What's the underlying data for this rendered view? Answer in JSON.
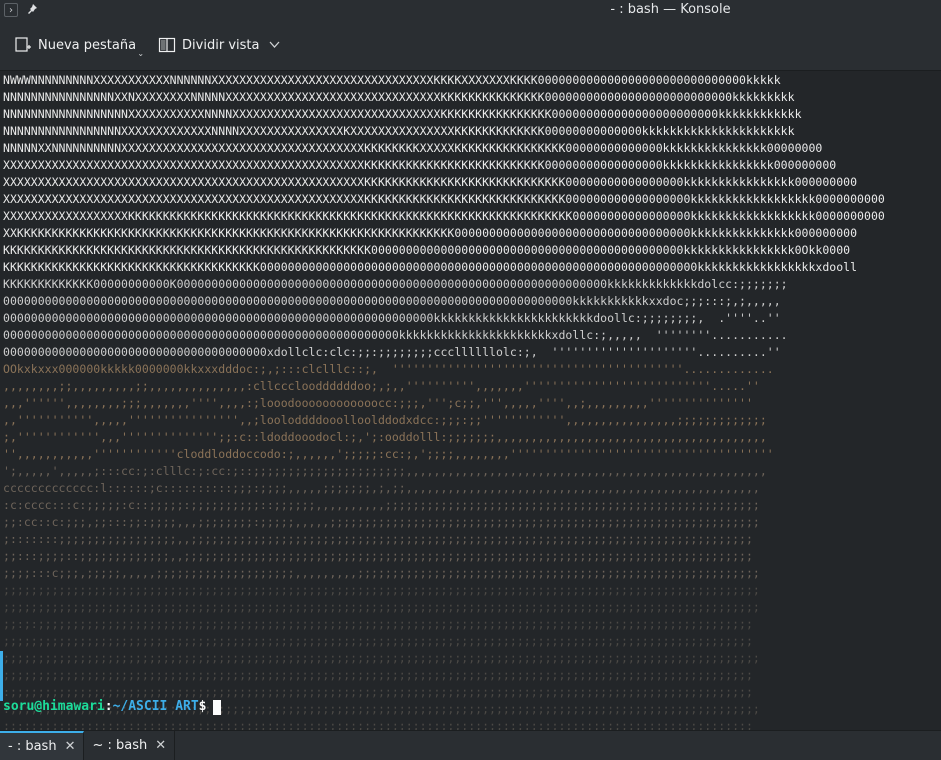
{
  "window": {
    "title": "- : bash — Konsole",
    "menu_icon": "chevron-right-icon",
    "pin_icon": "pin-icon"
  },
  "toolbar": {
    "new_tab_label": "Nueva pestaña",
    "split_view_label": "Dividir vista"
  },
  "terminal": {
    "art_lines": [
      "NWWWNNNNNNNNNXXXXXXXXXXXNNNNNNXXXXXXXXXXXXXXXXXXXXXXXXXXXXXXXXKKKKXXXXXXXKKKK000000000000000000000000000000kkkkk",
      "NNNNNNNNNNNNNNNNXXNXXXXXXXXNNNNNXXXXXXXXXXXXXXXXXXXXXXXXXXXXXXXKKKKKKKKKKKKKKK000000000000000000000000000kkkkkkkkk",
      "NNNNNNNNNNNNNNNNNNXXXXXXXXXXXNNNNXXXXXXXXXXXXXXXXXXXXXXXXXXXXXXKKKKKKKKKKKKKKKK000000000000000000000000kkkkkkkkkkkk",
      "NNNNNNNNNNNNNNNNNXXXXXXXXXXXXXNNNNXXXXXXXXXXXXXXXKXXXXXXXXXXXXXXXKKKKKKKKKKKKK00000000000000kkkkkkkkkkkkkkkkkkkkkk",
      "NNNNNXXNNNNNNNNNNXXXXXXXXXXXXXXXXXXXXXXXXXXXXXXXXXXXKKKKKKKKXXXXXKKKKKKKKKKKKKKKK00000000000000kkkkkkkkkkkkkkk00000000",
      "XXXXXXXXXXXXXXXXXXXXXXXXXXXXXXXXXXXXXXXXXXXXXXXXXXXXKKKKKKKKKKKKKKKKKKKKKKKKKK00000000000000000kkkkkkkkkkkkkkkk000000000",
      "XXXXXXXXXXXXXXXXXXXXXXXXXXXXXXXXXXXXXXXXXXXXXXXXXXXXKKKKKKKKKKKKKKKKKKKKKKKKKKKKK00000000000000000kkkkkkkkkkkkkkkk000000000",
      "XXXXXXXXXXXXXXXXXXXXXXXXXXXXXXXXXXXXXXXXXXXXXXXXXXXXKKKKKKKKKKKKKKKKKKKKKKKKKKKKK000000000000000000kkkkkkkkkkkkkkkkkk0000000000",
      "XXXXXXXXXXXXXXXXXXKKKKKKKKKKKKKKKKKKKKKKKKKKKKKKKKKKKKKKKKKKKKKKKKKKKKKKKKKKKKKKKK00000000000000000kkkkkkkkkkkkkkkkkk0000000000",
      "XXKKKKKKKKKKKKKKKKKKKKKKKKKKKKKKKKKKKKKKKKKKKKKKKKKKKKKKKKKKKKKKK0000000000000000000000000000000000kkkkkkkkkkkkkkk000000000",
      "KKKKKKKKKKKKKKKKKKKKKKKKKKKKKKKKKKKKKKKKKKKKKKKKKKKKK000000000000000000000000000000000000000000000kkkkkkkkkkkkkkkk0Okk0000",
      "KKKKKKKKKKKKKKKKKKKKKKKKKKKKKKKKKKKKK000000000000000000000000000000000000000000000000000000000000000kkkkkkkkkkkkkkkkkxdooll",
      "KKKKKKKKKKKKK00000000000K00000000000000000000000000000000000000000000000000000000000000kkkkkkkkkkkkkdolcc:;;;;;;;",
      "0000000000000000000000000000000000000000000000000000000000000000000000000000000000kkkkkkkkkkkxxdoc;;;:::;,;,,,,,",
      "00000000000000000000000000000000000000000000000000000000000000kkkkkkkkkkkkkkkkkkkkkkkdoollc:;;;;;;;;,  .''''..''",
      "000000000000000000000000000000000000000000000000000000000kkkkkkkkkkkkkkkkkkkkkkxdollc:;,,,,,  ''''''''...........",
      "00000000000000000000000000000000000000xdollclc:clc:;;:;;;;;;;;cccllllllolc:;,  '''''''''''''''''''''..........''",
      "OOkxkxxx000000kkkkk0000000kkxxxdddoc:;,;:::clclllc::;,  ''''''''''''''''''''''''''''''''''''''''''.............",
      ",,,,,,,,;;,,,,,,,,,;;,,,,,,,,,,,,,,:cllccclooddddddoo;,;,,'''''''''',,,,,,,'''''''''''''''''''''''''''.....''",
      ",,,'''''',,,,,,,,;;;,,,,,,,'''',,,,:;looodoooooooooooocc:;;;,''';c;;,''',,,,,'''',,;,,,,,,,,,'''''''''''''''",
      ",,''''''''''',,,,,'''''''''''''''',,;looloddddooolloolddodxdcc:;;;:;;'''''''''''',,,,,,,,,,,,,,,,;;;;;;;;;;;;;",
      ";,'''''''''''',,,'''''''''''''';;:c::ldoddooodocl:;,';:ooddolll:;;;;;;;,,,,,,,,,,,,,,,,,,,,,,,,,,,,,,,,,,,,,,,",
      "'',,,,,,,,,,,''''''''''''cloddloddoccodo:;,,,,,,';;;;;:cc:;,';;;;,,,,,,,,''''''''''''''''''''''''''''''''''''''",
      "';,,,,,',,,,,;:::cc:;:clllc:;:cc:;::;;;;;;;;;;;;;;;;;;;;;;,,,,,,,,,,,,,,,,,,,,,,,,,,,,,,,,,,,,,,,,,,,,,,,,,,,,",
      "ccccccccccccc:l::::::;c::::::::::;;;:;;;;,,,,,;;;;;;;,;,;;,,,,,,,,,,,,,,,,,,,,,,,,,,,,,,,,,,,,,,,,,,,,,,,,,,,",
      ":c:cccc:::c:;;;;;:c::;;;;;:;;;;;;;;;;::;;;;;;,,,,,,,,,,;;;;;;;;;;;;;;;;;;;;;;;;;;;;;;;;;;;;;;;;;;;;;;;;;;;;;;",
      ";;:cc::c:;;;,;;:::;;:;;;;,,,;;;;;;;;:;;;;;,,,,,;;;;;;;;;;;;;;;;;;;;;;;;;;;;;;;;;;;;;;;;;;;;;;;;;;;;;;;;;;;;;;",
      ";:::::::;;;;;;;;;;;;;;;;;,,;;;;;;;;;;;;;;;;;;;;;;;;;;;;;;;;;;;;;;;;;;;;;;;;;;;;;;;;;;;;;;;;;;;;;;;;;;;;;;;;;",
      ";;:::;;;;::;;;;;;;;;;;;;,,;;;;;;;;;;;;;;;;;;;;;;;;;;;;;;;;;;;;;;;;;;;;;;;;;;;;;;;;;;;;;;;;;;;;;;;;;;;;;;;;;;",
      ";;;;:::c;;;,;;;;;,,,,,;;;;;;;;;;;;;;;;;;;;,,,,,,,,,;;;;;;;;;;;;;;;;;;;;;;;;;;;;;;;;;;;;;;;;;;;;;;;;;;;;;;;;;;",
      ";;;;;;;;;;;;;;;;;;;;;;;;;;;;;;;;;;;;;;;;;;;;;;;;;;;;;;;;;;;;;;;;;;;;;;;;;;;;;;;;;;;;;;;;;;;;;;;;;;;;;;;;;;;;;",
      ";;;;;;;;;;;;;;;;;;;;;;;;;;;;;;;;;;;;;;;;;;;;;;;;;;;;;;;;;;;;;;;;;;;;;;;;;;;;;;;;;;;;;;;;;;;;;;;;;;;;;;;;;;;;;",
      ";;:;:;;;;;;;;;;;;;;;;;;;;;;;;;;;;;;;;;;;;;;;;;;;;;;;;;;;;;;;;;;;;;;;;;;;;;;;;;;;;;;;;;;;;;;;;;;;;;;;;;;;;;;;",
      ";;;;;;;;;;;;;;;;;;;;;;;;;;;;;;;;;;;;;;;;;;;;;;;;;;;;;;;;;;;;;;;;;;;;;;;;;;;;;;;;;;;;;;;;;;;;;;;;;;;;;;;;;;;;",
      ";;;;;;;;;;;;;;;;;;;;;;;;;;;;;;;;;;;;;;;;;;;;;;;;;;;;;;;;;;;;;;;;;;;;;;;;;;;;;;;;;;;;;;;;;;;;;;;;;;;;;;;;;;;;;",
      ";;;;;;;;;;;;;;;;;;;;;;;;;;;;;;;;;;;;;;;;;;;;;;;;;;;;;;;;;;;;;;;;;;;;;;;;;;;;;;;;;;;;;;;;;;;;;;;;;;;;;;;;;;;;",
      ":;;;;;;;;;;;;;;;;;;;;;;;;;;;;;;;;;;;;;;;;;;;;;;;;;;;;;;;;;;;;;;;;;;;;;;;;;;;;;;;;;;;;;;;;;;;;;;;;;;;;;;;;;;;",
      ":;;;;;;;;;;;;;;;;;;;;;;;;;;;;;;;;;;;;;;;;;;;;;;;;;;;;;;;;;;;;;;;;;;;;;;;;;;;;;;;;;;;;;;;;;;;;;;;;;;;;;;;;;;;;",
      ";;:;;;;;;;;;;;;;;;;;;;;;;;;;;;;;;;;;;;;;;;;;;;;;;;;;;;;;;;;;;;;;;;;;;;;;;;;;;;;;;;;;;;;;;;;;;;;;;;;;;;;;;;;;"
    ],
    "prompt_user": "soru@himawari",
    "prompt_colon": ":",
    "prompt_path": "~/ASCII ART",
    "prompt_symbol": "$"
  },
  "tabs": [
    {
      "label": "- : bash",
      "active": true
    },
    {
      "label": "~ : bash",
      "active": false
    }
  ],
  "colors": {
    "accent": "#3daee9",
    "prompt_user": "#1cdc9a",
    "background": "#232629"
  }
}
